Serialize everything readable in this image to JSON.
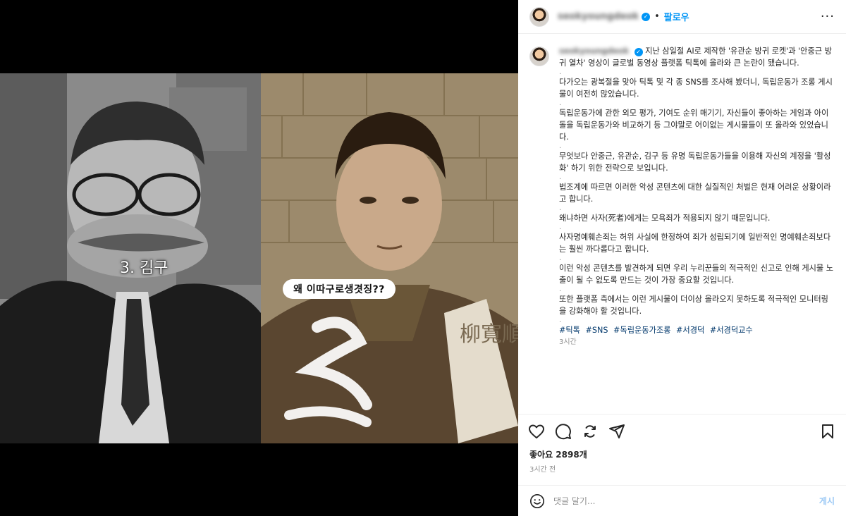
{
  "media": {
    "left_caption": "3. 김구",
    "speech_bubble": "왜  이따구로생겻징??",
    "sash_text": "柳寬順"
  },
  "header": {
    "username": "seokyoungdeok",
    "follow_label": "팔로우",
    "more_icon": "more-horizontal-icon"
  },
  "caption": {
    "username": "seokyoungdeok",
    "paragraphs": [
      "지난 삼일절 AI로 제작한 '유관순 방귀 로켓'과 '안중근 방귀 열차' 영상이 글로벌 동영상 플랫폼 틱톡에 올라와 큰 논란이 됐습니다.",
      "다가오는 광복절을 맞아 틱톡 및 각 종 SNS를 조사해 봤더니, 독립운동가 조롱 게시물이 여전히 많았습니다.",
      "독립운동가에 관한 외모 평가, 기여도 순위 매기기, 자신들이 좋아하는 게임과 아이돌을 독립운동가와 비교하기 등 그야말로 어이없는 게시물들이 또 올라와 있었습니다.",
      "무엇보다 안중근, 유관순, 김구 등 유명 독립운동가들을 이용해 자신의 계정을 '활성화' 하기 위한 전략으로 보입니다.",
      "법조계에 따르면 이러한 악성 콘텐츠에 대한 실질적인 처벌은 현재 어려운 상황이라고 합니다.",
      "왜냐하면 사자(死者)에게는 모욕죄가 적용되지 않기 때문입니다.",
      "사자명예훼손죄는 허위 사실에 한정하여 죄가 성립되기에 일반적인 명예훼손죄보다는 훨씬 까다롭다고 합니다.",
      "이런 악성 콘텐츠를 발견하게 되면 우리 누리꾼들의 적극적인 신고로 인해 게시물 노출이 될 수 없도록 만드는 것이 가장 중요할 것입니다.",
      "또한 플랫폼 측에서는 이런 게시물이 더이상 올라오지 못하도록 적극적인 모니터링을 강화해야 할 것입니다."
    ],
    "separator": ".",
    "hashtags": [
      "#틱톡",
      "#SNS",
      "#독립운동가조롱",
      "#서경덕",
      "#서경덕교수"
    ],
    "time_ago": "3시간"
  },
  "actions": {
    "icons": [
      "heart-icon",
      "comment-icon",
      "repost-icon",
      "share-icon",
      "bookmark-icon"
    ]
  },
  "likes_text": "좋아요 2898개",
  "post_time": "3시간 전",
  "comment": {
    "placeholder": "댓글 달기...",
    "post_label": "게시"
  },
  "colors": {
    "accent": "#0095f6",
    "hashtag": "#00376b",
    "muted": "#8e8e8e"
  }
}
